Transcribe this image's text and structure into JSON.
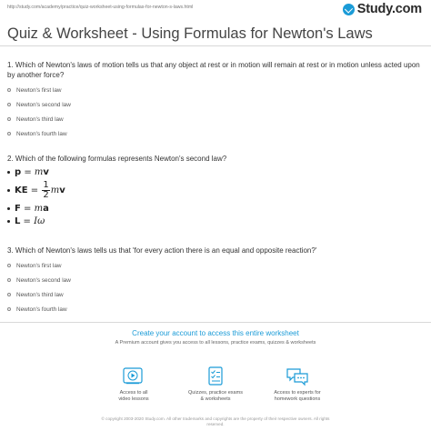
{
  "header": {
    "url": "http://study.com/academy/practice/quiz-worksheet-using-formulas-for-newton-s-laws.html",
    "logo": "Study.com",
    "title": "Quiz & Worksheet - Using Formulas for Newton's Laws"
  },
  "questions": [
    {
      "text": "1. Which of Newton's laws of motion tells us that any object at rest or in motion will remain at rest or in motion unless acted upon by another force?",
      "options": [
        "Newton's first law",
        "Newton's second law",
        "Newton's third law",
        "Newton's fourth law"
      ]
    },
    {
      "text": "2. Which of the following formulas represents Newton's second law?",
      "formulas": {
        "f1": {
          "lhs": "p",
          "eq": " = ",
          "var": "m",
          "vec": "v"
        },
        "f2": {
          "lhs": "KE",
          "eq": " = ",
          "num": "1",
          "den": "2",
          "var": "m",
          "vec": "v"
        },
        "f3": {
          "lhs": "F",
          "eq": " = ",
          "var": "m",
          "vec": "a"
        },
        "f4": {
          "lhs": "L",
          "eq": " = ",
          "var": "Iω"
        }
      }
    },
    {
      "text": "3. Which of Newton's laws tells us that 'for every action there is an equal and opposite reaction?'",
      "options": [
        "Newton's first law",
        "Newton's second law",
        "Newton's third law",
        "Newton's fourth law"
      ]
    }
  ],
  "promo": {
    "title": "Create your account to access this entire worksheet",
    "subtitle": "A Premium account gives you access to all lessons, practice exams, quizzes & worksheets",
    "features": [
      {
        "line1": "Access to all",
        "line2": "video lessons",
        "icon": "video-icon"
      },
      {
        "line1": "Quizzes, practice exams",
        "line2": "& worksheets",
        "icon": "quiz-icon"
      },
      {
        "line1": "Access to experts for",
        "line2": "homework questions",
        "icon": "chat-icon"
      }
    ],
    "accent_color": "#1a9bd7"
  },
  "footer": {
    "line1": "© copyright 2003-2020 Study.com. All other trademarks and copyrights are the property of their respective owners. All rights",
    "line2": "reserved."
  }
}
